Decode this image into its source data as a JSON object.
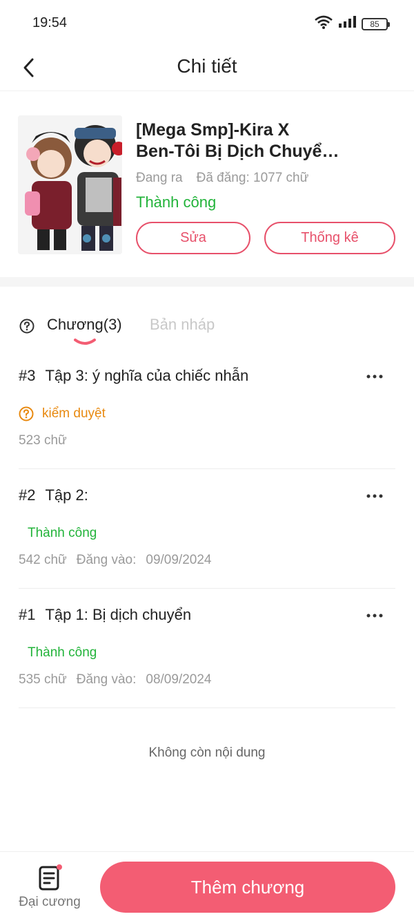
{
  "status_bar": {
    "time": "19:54",
    "battery": "85"
  },
  "header": {
    "title": "Chi tiết"
  },
  "story": {
    "title_line1": "[Mega Smp]-Kira X",
    "title_line2": "Ben-Tôi Bị Dịch Chuyể…",
    "state": "Đang ra",
    "words": "Đã đăng: 1077 chữ",
    "status": "Thành công",
    "edit_label": "Sửa",
    "stats_label": "Thống kê"
  },
  "tabs": {
    "chapters": "Chương(3)",
    "drafts": "Bản nháp"
  },
  "chapters": [
    {
      "num": "#3",
      "title": "Tập 3: ý nghĩa của chiếc nhẫn",
      "status": "kiểm duyệt",
      "words": "523 chữ",
      "posted_label": "",
      "date": ""
    },
    {
      "num": "#2",
      "title": "Tập 2:",
      "status": "Thành công",
      "words": "542 chữ",
      "posted_label": "Đăng vào:",
      "date": "09/09/2024"
    },
    {
      "num": "#1",
      "title": "Tập 1: Bị dịch chuyển",
      "status": "Thành công",
      "words": "535 chữ",
      "posted_label": "Đăng vào:",
      "date": "08/09/2024"
    }
  ],
  "end_text": "Không còn nội dung",
  "bottom": {
    "outline_label": "Đại cương",
    "add_label": "Thêm chương"
  },
  "colors": {
    "accent": "#f35d73",
    "success": "#22b33a",
    "warning": "#e8890f"
  },
  "icons": [
    "back-arrow-icon",
    "wifi-icon",
    "signal-icon",
    "battery-icon",
    "help-circle-icon",
    "more-icon",
    "outline-document-icon"
  ]
}
